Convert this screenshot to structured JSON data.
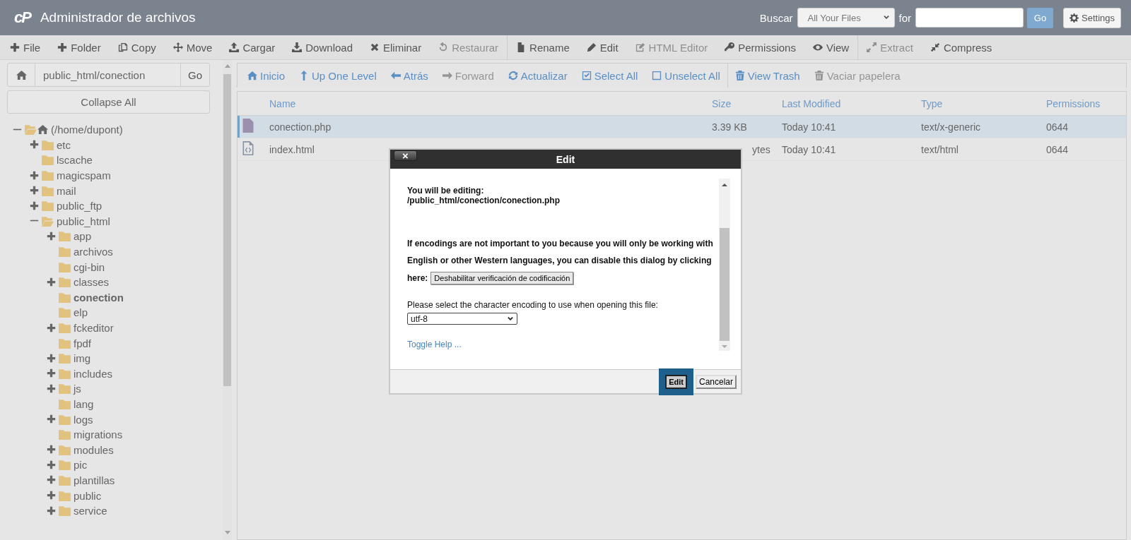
{
  "header": {
    "logo": "cP",
    "title": "Administrador de archivos",
    "search_label": "Buscar",
    "search_scope": "All Your Files",
    "for_label": "for",
    "go": "Go",
    "settings": "Settings"
  },
  "toolbar": [
    {
      "label": "File",
      "disabled": false,
      "group_end": false
    },
    {
      "label": "Folder",
      "disabled": false,
      "group_end": false
    },
    {
      "label": "Copy",
      "disabled": false,
      "group_end": false
    },
    {
      "label": "Move",
      "disabled": false,
      "group_end": false
    },
    {
      "label": "Cargar",
      "disabled": false,
      "group_end": false
    },
    {
      "label": "Download",
      "disabled": false,
      "group_end": false
    },
    {
      "label": "Eliminar",
      "disabled": false,
      "group_end": false
    },
    {
      "label": "Restaurar",
      "disabled": true,
      "group_end": true
    },
    {
      "label": "Rename",
      "disabled": false,
      "group_end": false
    },
    {
      "label": "Edit",
      "disabled": false,
      "group_end": false
    },
    {
      "label": "HTML Editor",
      "disabled": true,
      "group_end": false
    },
    {
      "label": "Permissions",
      "disabled": false,
      "group_end": false
    },
    {
      "label": "View",
      "disabled": false,
      "group_end": true
    },
    {
      "label": "Extract",
      "disabled": true,
      "group_end": false
    },
    {
      "label": "Compress",
      "disabled": false,
      "group_end": false
    }
  ],
  "sidebar": {
    "path": "public_html/conection",
    "go": "Go",
    "collapse_all": "Collapse All",
    "tree": [
      {
        "label": "(/home/dupont)",
        "kind": "branch",
        "expanded": true,
        "selected": false,
        "children": [
          {
            "label": "etc",
            "kind": "branch",
            "expanded": false,
            "selected": false
          },
          {
            "label": "lscache",
            "kind": "leaf",
            "expanded": false,
            "selected": false
          },
          {
            "label": "magicspam",
            "kind": "branch",
            "expanded": false,
            "selected": false
          },
          {
            "label": "mail",
            "kind": "branch",
            "expanded": false,
            "selected": false
          },
          {
            "label": "public_ftp",
            "kind": "branch",
            "expanded": false,
            "selected": false
          },
          {
            "label": "public_html",
            "kind": "branch",
            "expanded": true,
            "selected": false,
            "children": [
              {
                "label": "app",
                "kind": "branch",
                "expanded": false,
                "selected": false
              },
              {
                "label": "archivos",
                "kind": "leaf",
                "expanded": false,
                "selected": false
              },
              {
                "label": "cgi-bin",
                "kind": "leaf",
                "expanded": false,
                "selected": false
              },
              {
                "label": "classes",
                "kind": "branch",
                "expanded": false,
                "selected": false
              },
              {
                "label": "conection",
                "kind": "leaf",
                "expanded": false,
                "selected": true
              },
              {
                "label": "elp",
                "kind": "leaf",
                "expanded": false,
                "selected": false
              },
              {
                "label": "fckeditor",
                "kind": "branch",
                "expanded": false,
                "selected": false
              },
              {
                "label": "fpdf",
                "kind": "leaf",
                "expanded": false,
                "selected": false
              },
              {
                "label": "img",
                "kind": "branch",
                "expanded": false,
                "selected": false
              },
              {
                "label": "includes",
                "kind": "branch",
                "expanded": false,
                "selected": false
              },
              {
                "label": "js",
                "kind": "branch",
                "expanded": false,
                "selected": false
              },
              {
                "label": "lang",
                "kind": "leaf",
                "expanded": false,
                "selected": false
              },
              {
                "label": "logs",
                "kind": "branch",
                "expanded": false,
                "selected": false
              },
              {
                "label": "migrations",
                "kind": "leaf",
                "expanded": false,
                "selected": false
              },
              {
                "label": "modules",
                "kind": "branch",
                "expanded": false,
                "selected": false
              },
              {
                "label": "pic",
                "kind": "branch",
                "expanded": false,
                "selected": false
              },
              {
                "label": "plantillas",
                "kind": "branch",
                "expanded": false,
                "selected": false
              },
              {
                "label": "public",
                "kind": "branch",
                "expanded": false,
                "selected": false
              },
              {
                "label": "service",
                "kind": "branch",
                "expanded": false,
                "selected": false
              }
            ]
          }
        ]
      }
    ]
  },
  "nav": [
    {
      "label": "Inicio",
      "disabled": false,
      "group_end": false
    },
    {
      "label": "Up One Level",
      "disabled": false,
      "group_end": false
    },
    {
      "label": "Atrás",
      "disabled": false,
      "group_end": false
    },
    {
      "label": "Forward",
      "disabled": true,
      "group_end": false
    },
    {
      "label": "Actualizar",
      "disabled": false,
      "group_end": false
    },
    {
      "label": "Select All",
      "disabled": false,
      "group_end": false
    },
    {
      "label": "Unselect All",
      "disabled": false,
      "group_end": true
    },
    {
      "label": "View Trash",
      "disabled": false,
      "group_end": false
    },
    {
      "label": "Vaciar papelera",
      "disabled": true,
      "group_end": false
    }
  ],
  "table": {
    "columns": [
      "Name",
      "Size",
      "Last Modified",
      "Type",
      "Permissions"
    ],
    "rows": [
      {
        "kind": "text",
        "selected": true,
        "cells": [
          "conection.php",
          "3.39 KB",
          "Today 10:41",
          "text/x-generic",
          "0644"
        ]
      },
      {
        "kind": "code",
        "selected": false,
        "cells": [
          "index.html",
          "ytes",
          "Today 10:41",
          "text/html",
          "0644"
        ]
      }
    ]
  },
  "dialog": {
    "title": "Edit",
    "close": "×",
    "editing_label": "You will be editing:",
    "editing_path": "/public_html/conection/conection.php",
    "info": "If encodings are not important to you because you will only be working with English or other Western languages, you can disable this dialog by clicking",
    "here": "here:",
    "disable_button": "Deshabilitar verificación de codificación",
    "encoding_label": "Please select the character encoding to use when opening this file:",
    "encoding": "utf-8",
    "toggle_help": "Toggle Help ...",
    "buttons": [
      {
        "label": "Edit",
        "focused": true
      },
      {
        "label": "Cancelar",
        "focused": false
      }
    ]
  }
}
